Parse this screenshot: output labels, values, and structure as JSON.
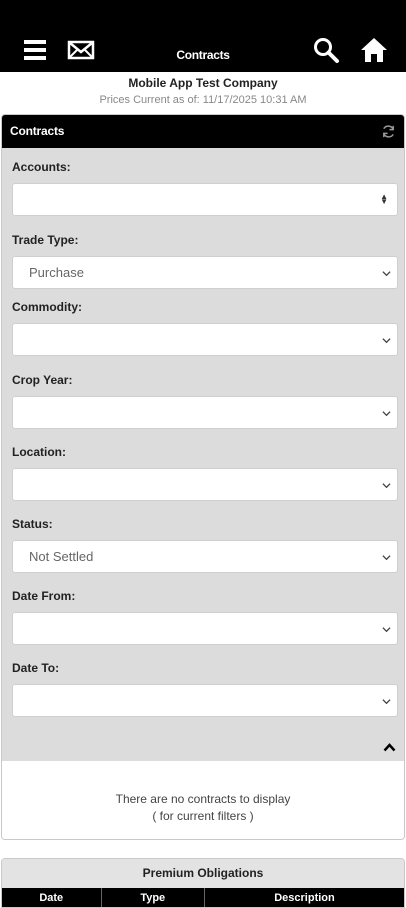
{
  "header": {
    "title": "Contracts",
    "icons": [
      "menu-icon",
      "mail-icon",
      "search-icon",
      "home-icon"
    ]
  },
  "company_name": "Mobile App Test Company",
  "prices_current": "Prices Current as of: 11/17/2025 10:31 AM",
  "panel": {
    "title": "Contracts",
    "fields": {
      "accounts": {
        "label": "Accounts:",
        "value": ""
      },
      "trade_type": {
        "label": "Trade Type:",
        "value": "Purchase"
      },
      "commodity": {
        "label": "Commodity:",
        "value": ""
      },
      "crop_year": {
        "label": "Crop Year:",
        "value": ""
      },
      "location": {
        "label": "Location:",
        "value": ""
      },
      "status": {
        "label": "Status:",
        "value": "Not Settled"
      },
      "date_from": {
        "label": "Date From:",
        "value": ""
      },
      "date_to": {
        "label": "Date To:",
        "value": ""
      }
    },
    "empty_message": "There are no contracts to display",
    "empty_sub": "( for current filters )"
  },
  "premium": {
    "title": "Premium Obligations",
    "columns": [
      "Date",
      "Type",
      "Description"
    ]
  },
  "colors": {
    "header_bg": "#000000",
    "panel_bg": "#dcdcdc"
  }
}
